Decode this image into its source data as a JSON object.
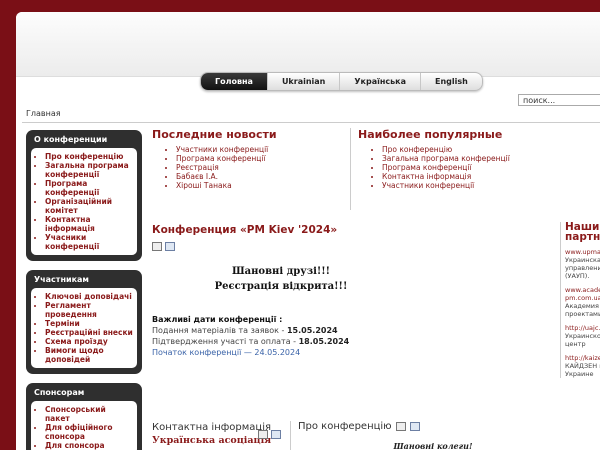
{
  "menu": [
    "Головна",
    "Ukrainian",
    "Українська",
    "English"
  ],
  "search_placeholder": "поиск...",
  "breadcrumb": "Главная",
  "modules": [
    {
      "title": "О конференции",
      "items": [
        "Про конференцію",
        "Загальна програма конференції",
        "Програма конференції",
        "Організаційний комітет",
        "Контактна інформація",
        "Учасники конференції"
      ]
    },
    {
      "title": "Участникам",
      "items": [
        "Ключові доповідачі",
        "Регламент проведення",
        "Терміни",
        "Реєстраційні внески",
        "Схема проїзду",
        "Вимоги щодо доповідей"
      ]
    },
    {
      "title": "Спонсорам",
      "items": [
        "Спонсорський пакет",
        "Для офіційного спонсора",
        "Для спонсора"
      ]
    }
  ],
  "news": {
    "title": "Последние новости",
    "items": [
      "Участники конференції",
      "Програма конференції",
      "Реєстрація",
      "Бабаєв І.А.",
      "Хіроші Танака"
    ]
  },
  "popular": {
    "title": "Наиболее популярные",
    "items": [
      "Про конференцію",
      "Загальна програма конференції",
      "Програма конференції",
      "Контактна інформація",
      "Участники конференції"
    ]
  },
  "conference": {
    "title": "Конференция «PM Kiev '2024»",
    "greeting1": "Шановні друзі!!!",
    "greeting2": "Реєстрація відкрита!!!",
    "dates_title": "Важливі дати конференції :",
    "submission_label": "Подання матеріалів та заявок - ",
    "submission_date": "15.05.2024",
    "confirm_label": "Підтвердження участі та оплата - ",
    "confirm_date": "18.05.2024",
    "start": "Початок конференції — 24.05.2024"
  },
  "partners": {
    "title1": "Наши",
    "title2": "партнё",
    "items": [
      {
        "link": "www.upma.k",
        "text": [
          "Украинская",
          "управления",
          "(УАУП)."
        ]
      },
      {
        "link": "www.acader",
        "link2": "pm.com.ua",
        "text": [
          "Академия у",
          "проектами"
        ]
      },
      {
        "link": "http://uajc.c",
        "text": [
          "Украинско-",
          "центр"
        ]
      },
      {
        "link": "http://kaizen",
        "text": [
          "КАЙДЗЕН ка",
          "Украине"
        ]
      }
    ]
  },
  "contact": {
    "title": "Контактна інформація",
    "org": "Українська асоціація"
  },
  "about": {
    "title": "Про конференцію",
    "greeting": "Шановні колеги!"
  }
}
